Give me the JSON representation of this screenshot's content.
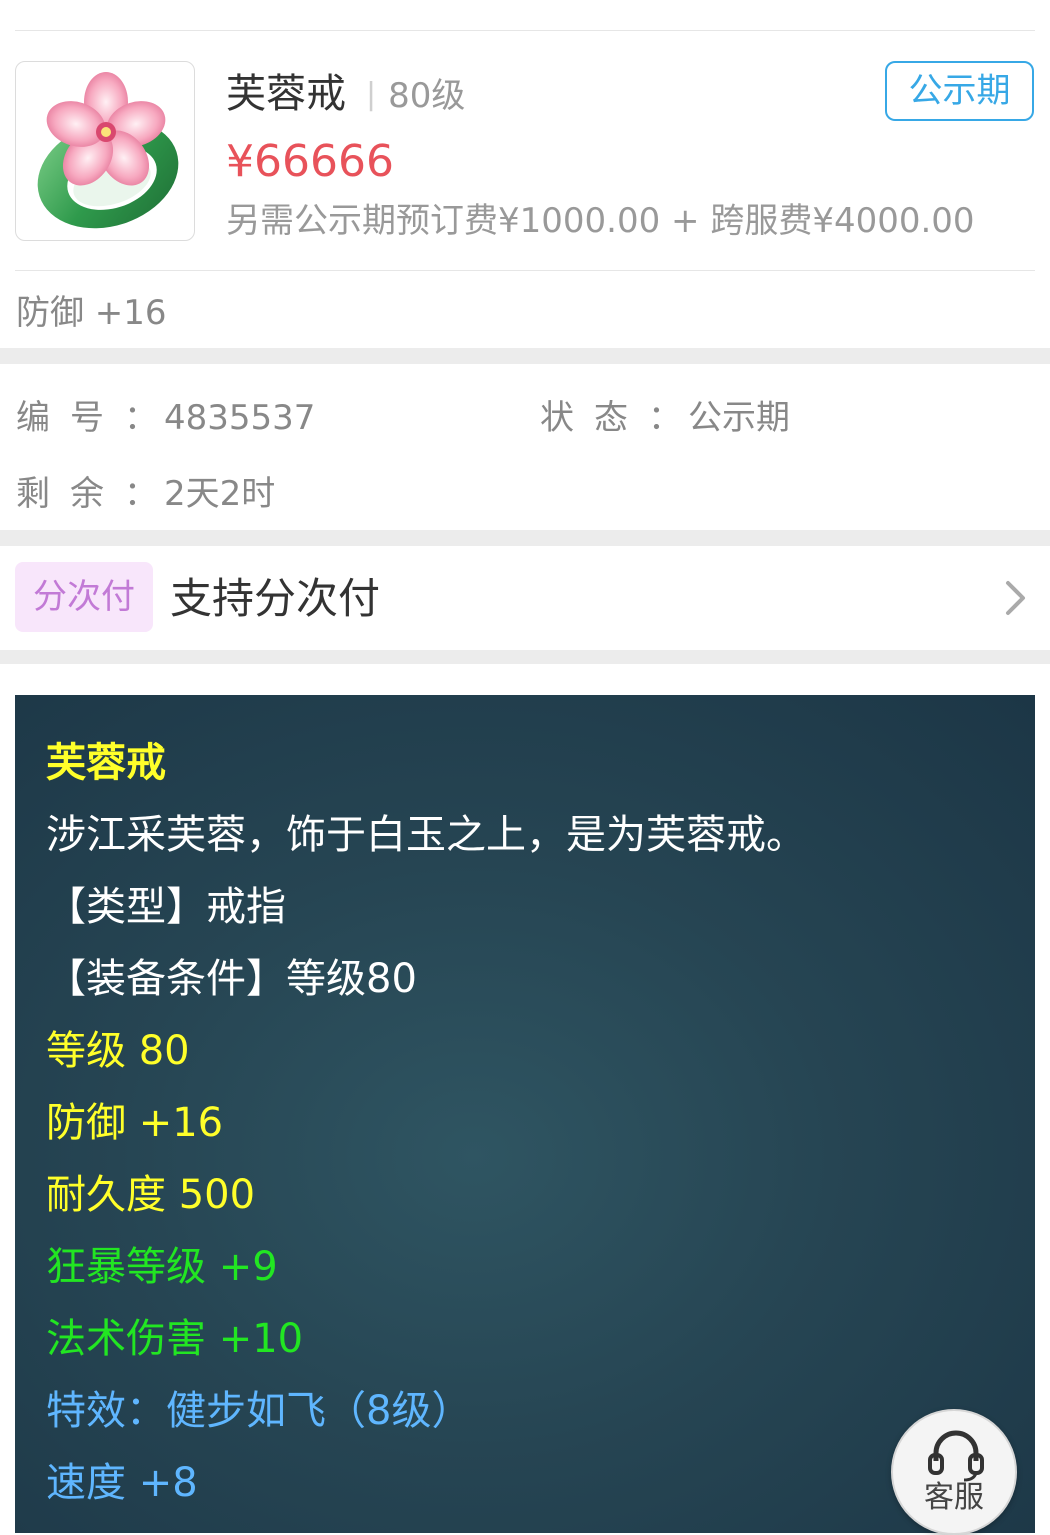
{
  "item": {
    "name": "芙蓉戒",
    "level_text": "80级",
    "price": "¥66666",
    "extra_fee": "另需公示期预订费¥1000.00 + 跨服费¥4000.00",
    "status_tag": "公示期",
    "attr_summary": "防御 +16",
    "thumbnail_icon": "jade-ring-with-pink-flower-icon"
  },
  "info": {
    "id_label": "编号",
    "id_value": "4835537",
    "status_label": "状态",
    "status_value": "公示期",
    "remain_label": "剩余",
    "remain_value": "2天2时",
    "colon": "："
  },
  "installment": {
    "tag": "分次付",
    "text": "支持分次付",
    "icon": "chevron-right-icon"
  },
  "description": {
    "name": "芙蓉戒",
    "flavor": "涉江采芙蓉，饰于白玉之上，是为芙蓉戒。",
    "type_line": "【类型】戒指",
    "requirement_line": "【装备条件】等级80",
    "stats_yellow": [
      "等级 80",
      "防御 +16",
      "耐久度 500"
    ],
    "stats_green": [
      "狂暴等级 +9",
      "法术伤害 +10"
    ],
    "special": "特效：健步如飞（8级）",
    "speed": "速度 +8"
  },
  "service": {
    "label": "客服",
    "icon": "headset-icon"
  },
  "colors": {
    "price": "#e8525a",
    "status": "#37a8e6",
    "installment_tag_bg": "#f8e6fb",
    "installment_tag_text": "#c27ad6",
    "panel_bg": "#264553",
    "yellow": "#ffff2a",
    "green": "#22e622",
    "blue": "#5fb6ff"
  }
}
